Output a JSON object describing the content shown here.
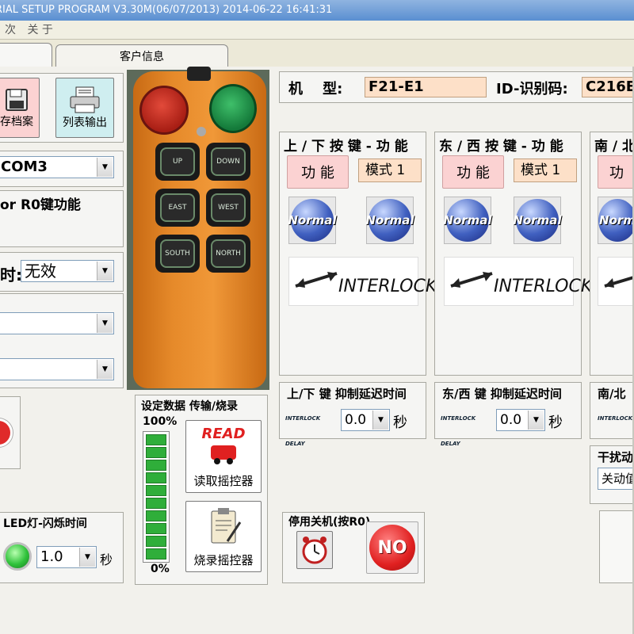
{
  "window": {
    "title": "RIAL SETUP PROGRAM V3.30M(06/07/2013)  2014-06-22  16:41:31"
  },
  "menu": {
    "items": [
      "次",
      "关 于"
    ]
  },
  "tabs": [
    {
      "label": ""
    },
    {
      "label": "客户信息"
    }
  ],
  "left": {
    "save_label": "存档案",
    "print_label": "列表输出",
    "port_value": "COM3",
    "r0_label": "or R0键功能",
    "time_label": "时:",
    "time_value": "无效",
    "led_label": "LED灯-闪烁时间",
    "led_value": "1.0",
    "led_unit": "秒"
  },
  "remote": {
    "buttons": [
      "UP",
      "DOWN",
      "EAST",
      "WEST",
      "SOUTH",
      "NORTH"
    ]
  },
  "transfer": {
    "title": "设定数据 传输/烧录",
    "top_pct": "100%",
    "bottom_pct": "0%",
    "progress": 1.0,
    "read_label": "读取摇控器",
    "burn_label": "烧录摇控器",
    "read_icon_text": "READ"
  },
  "model": {
    "model_label": "机    型:",
    "model_value": "F21-E1",
    "id_label": "ID-识别码:",
    "id_value": "C216E"
  },
  "groups": [
    {
      "title": "上 / 下 按 键 - 功 能",
      "func_label": "功 能",
      "mode_label": "模式 1",
      "normal1": "Normal",
      "normal2": "Normal",
      "interlock": "INTERLOCK"
    },
    {
      "title": "东 / 西 按 键 - 功 能",
      "func_label": "功 能",
      "mode_label": "模式 1",
      "normal1": "Normal",
      "normal2": "Normal",
      "interlock": "INTERLOCK"
    },
    {
      "title": "南 / 北",
      "func_label": "功",
      "mode_label": "",
      "normal1": "Norm",
      "normal2": "",
      "interlock": ""
    }
  ],
  "delays": [
    {
      "title": "上/下 键 抑制延迟时间",
      "value": "0.0",
      "unit": "秒",
      "icon_text": "INTERLOCK DELAY"
    },
    {
      "title": "东/西 键 抑制延迟时间",
      "value": "0.0",
      "unit": "秒",
      "icon_text": "INTERLOCK DELAY"
    },
    {
      "title": "南/北",
      "value": "",
      "unit": "",
      "icon_text": "INTERLOCK DELAY"
    }
  ],
  "shutdown": {
    "title": "停用关机(按R0)",
    "no_text": "NO"
  },
  "interference": {
    "title": "干扰动",
    "value": "关动值"
  }
}
